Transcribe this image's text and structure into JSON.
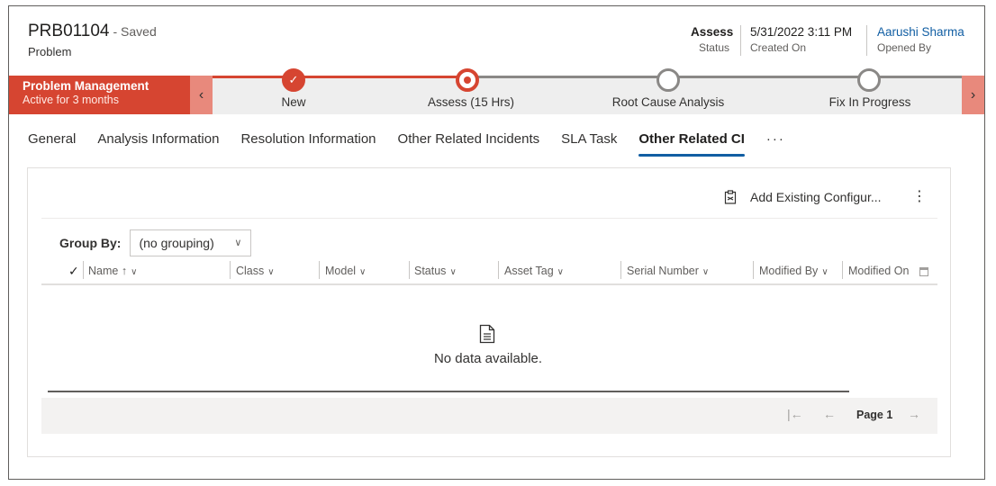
{
  "header": {
    "record_id": "PRB01104",
    "save_state": "- Saved",
    "entity": "Problem",
    "fields": [
      {
        "value": "Assess",
        "label": "Status"
      },
      {
        "value": "5/31/2022 3:11 PM",
        "label": "Created On"
      },
      {
        "value": "Aarushi Sharma",
        "label": "Opened By"
      }
    ]
  },
  "process": {
    "name": "Problem Management",
    "duration": "Active for 3 months",
    "prev_icon": "chevron-left-icon",
    "next_icon": "chevron-right-icon",
    "stages": [
      {
        "label": "New",
        "state": "done"
      },
      {
        "label": "Assess  (15 Hrs)",
        "state": "active"
      },
      {
        "label": "Root Cause Analysis",
        "state": "todo"
      },
      {
        "label": "Fix In Progress",
        "state": "todo"
      }
    ],
    "active_color": "#d64531"
  },
  "tabs": [
    {
      "label": "General"
    },
    {
      "label": "Analysis Information"
    },
    {
      "label": "Resolution Information"
    },
    {
      "label": "Other Related Incidents"
    },
    {
      "label": "SLA Task"
    },
    {
      "label": "Other Related CI",
      "active": true
    },
    {
      "label": "···"
    }
  ],
  "subgrid": {
    "add_existing_label": "Add Existing Configur...",
    "more_label": "⋮",
    "group_by_label": "Group By:",
    "group_by_value": "(no grouping)",
    "columns": [
      {
        "label": "Name ↑"
      },
      {
        "label": "Class"
      },
      {
        "label": "Model"
      },
      {
        "label": "Status"
      },
      {
        "label": "Asset Tag"
      },
      {
        "label": "Serial Number"
      },
      {
        "label": "Modified By"
      },
      {
        "label": "Modified On"
      }
    ],
    "empty_text": "No data available.",
    "page_label": "Page 1"
  },
  "colors": {
    "accent": "#115ea3",
    "process_active": "#d64531"
  }
}
